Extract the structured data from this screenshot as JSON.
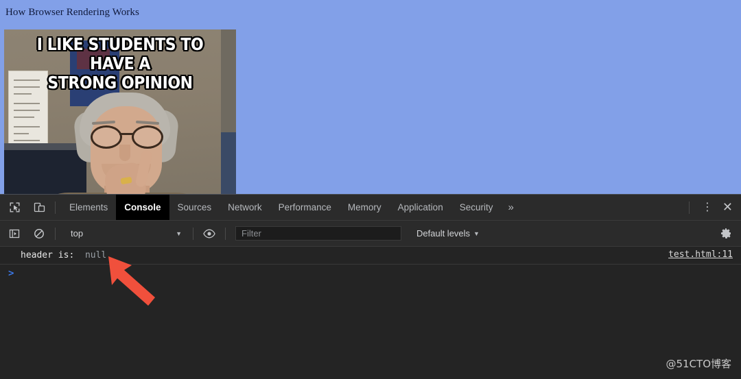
{
  "page": {
    "background_color": "#82a0e8",
    "title": "How Browser Rendering Works",
    "meme": {
      "text_line1": "I LIKE STUDENTS TO HAVE A",
      "text_line2": "STRONG OPINION",
      "alt": "meme-photo-professor"
    }
  },
  "devtools": {
    "toolbar_icons": {
      "inspect": "inspect-element-icon",
      "device": "device-toolbar-icon"
    },
    "tabs": [
      {
        "label": "Elements",
        "active": false
      },
      {
        "label": "Console",
        "active": true
      },
      {
        "label": "Sources",
        "active": false
      },
      {
        "label": "Network",
        "active": false
      },
      {
        "label": "Performance",
        "active": false
      },
      {
        "label": "Memory",
        "active": false
      },
      {
        "label": "Application",
        "active": false
      },
      {
        "label": "Security",
        "active": false
      }
    ],
    "more_tabs": "»",
    "menu": "⋮",
    "close": "✕",
    "filterbar": {
      "sidebar_toggle": "console-sidebar-icon",
      "clear_console": "clear-console-icon",
      "context": "top",
      "context_caret": "▼",
      "eye": "live-expression-icon",
      "filter_placeholder": "Filter",
      "filter_value": "",
      "levels": "Default levels",
      "levels_caret": "▼",
      "settings": "settings-gear-icon"
    },
    "console": {
      "message_label": "header is:",
      "message_value": "null",
      "source_link": "test.html:11",
      "prompt": ">"
    },
    "accent_colors": {
      "prompt_blue": "#3b78e7",
      "arrow_red": "#f0503c",
      "panel_bg": "#242424",
      "toolbar_bg": "#2b2b2b"
    }
  },
  "watermark": "@51CTO博客"
}
